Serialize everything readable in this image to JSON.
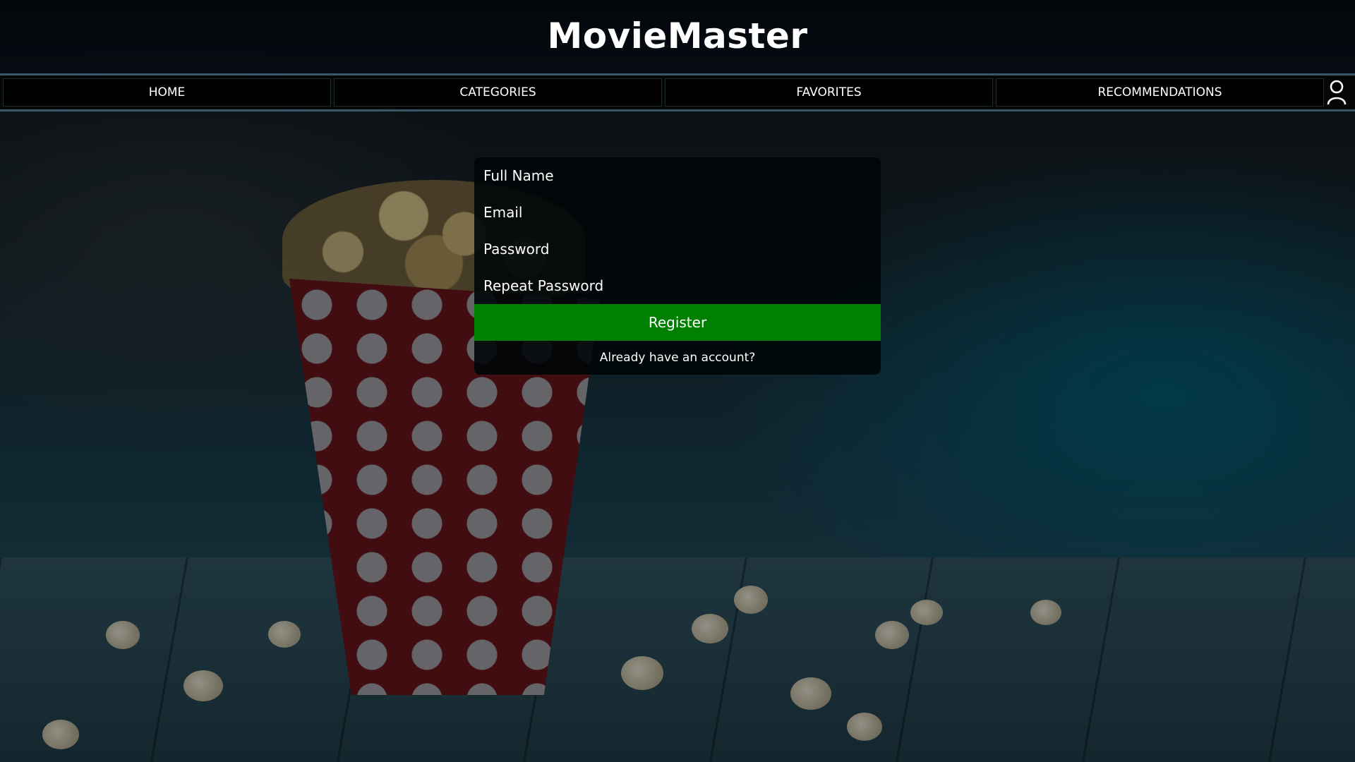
{
  "site": {
    "title": "MovieMaster"
  },
  "nav": {
    "items": [
      {
        "label": "HOME"
      },
      {
        "label": "CATEGORIES"
      },
      {
        "label": "FAVORITES"
      },
      {
        "label": "RECOMMENDATIONS"
      }
    ],
    "user_icon": "user-icon"
  },
  "form": {
    "full_name_placeholder": "Full Name",
    "full_name_value": "",
    "email_placeholder": "Email",
    "email_value": "",
    "password_placeholder": "Password",
    "password_value": "",
    "repeat_password_placeholder": "Repeat Password",
    "repeat_password_value": "",
    "register_label": "Register",
    "login_link_label": "Already have an account?"
  },
  "colors": {
    "register_button": "#008000",
    "form_background": "#000508",
    "nav_border": "#3a5869"
  }
}
